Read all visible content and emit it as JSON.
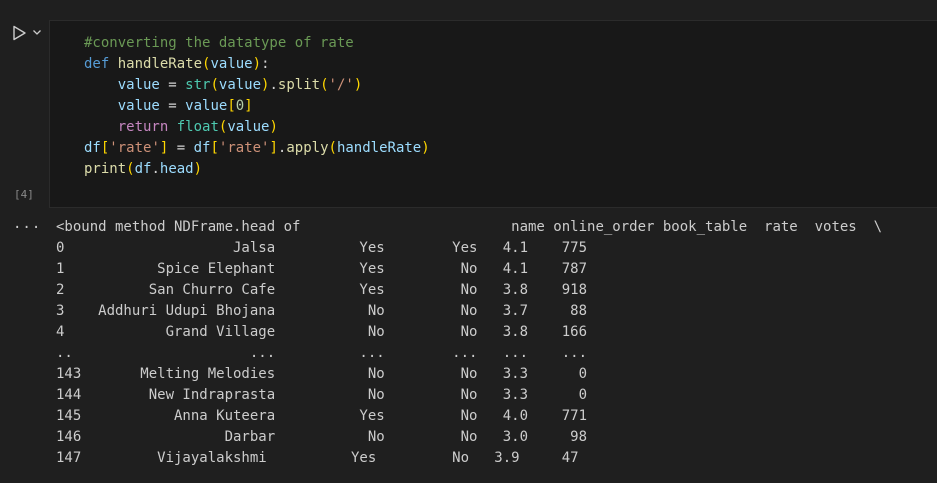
{
  "cell": {
    "execution_count": "[4]",
    "run_icon": "play-icon",
    "chevron_icon": "chevron-down-icon",
    "code_lines": [
      [
        {
          "t": "#converting the datatype of rate",
          "c": "comment"
        }
      ],
      [
        {
          "t": "def",
          "c": "kw"
        },
        {
          "t": " ",
          "c": "op"
        },
        {
          "t": "handleRate",
          "c": "fn"
        },
        {
          "t": "(",
          "c": "paren1"
        },
        {
          "t": "value",
          "c": "var"
        },
        {
          "t": ")",
          "c": "paren1"
        },
        {
          "t": ":",
          "c": "op"
        }
      ],
      [
        {
          "t": "    value",
          "c": "var"
        },
        {
          "t": " = ",
          "c": "op"
        },
        {
          "t": "str",
          "c": "builtin"
        },
        {
          "t": "(",
          "c": "paren1"
        },
        {
          "t": "value",
          "c": "var"
        },
        {
          "t": ")",
          "c": "paren1"
        },
        {
          "t": ".",
          "c": "op"
        },
        {
          "t": "split",
          "c": "fn"
        },
        {
          "t": "(",
          "c": "paren1"
        },
        {
          "t": "'/'",
          "c": "str"
        },
        {
          "t": ")",
          "c": "paren1"
        }
      ],
      [
        {
          "t": "    value",
          "c": "var"
        },
        {
          "t": " = ",
          "c": "op"
        },
        {
          "t": "value",
          "c": "var"
        },
        {
          "t": "[",
          "c": "paren1"
        },
        {
          "t": "0",
          "c": "num"
        },
        {
          "t": "]",
          "c": "paren1"
        }
      ],
      [
        {
          "t": "    return",
          "c": "ctrl"
        },
        {
          "t": " ",
          "c": "op"
        },
        {
          "t": "float",
          "c": "builtin"
        },
        {
          "t": "(",
          "c": "paren1"
        },
        {
          "t": "value",
          "c": "var"
        },
        {
          "t": ")",
          "c": "paren1"
        }
      ],
      [
        {
          "t": "df",
          "c": "var"
        },
        {
          "t": "[",
          "c": "paren1"
        },
        {
          "t": "'rate'",
          "c": "str"
        },
        {
          "t": "]",
          "c": "paren1"
        },
        {
          "t": " = ",
          "c": "op"
        },
        {
          "t": "df",
          "c": "var"
        },
        {
          "t": "[",
          "c": "paren1"
        },
        {
          "t": "'rate'",
          "c": "str"
        },
        {
          "t": "]",
          "c": "paren1"
        },
        {
          "t": ".",
          "c": "op"
        },
        {
          "t": "apply",
          "c": "fn"
        },
        {
          "t": "(",
          "c": "paren1"
        },
        {
          "t": "handleRate",
          "c": "var"
        },
        {
          "t": ")",
          "c": "paren1"
        }
      ],
      [
        {
          "t": "print",
          "c": "fn"
        },
        {
          "t": "(",
          "c": "paren1"
        },
        {
          "t": "df",
          "c": "var"
        },
        {
          "t": ".",
          "c": "op"
        },
        {
          "t": "head",
          "c": "var"
        },
        {
          "t": ")",
          "c": "paren1"
        }
      ]
    ]
  },
  "output": {
    "more_label": "...",
    "lines": [
      "<bound method NDFrame.head of                         name online_order book_table  rate  votes  \\",
      "0                    Jalsa          Yes        Yes   4.1    775",
      "1           Spice Elephant          Yes         No   4.1    787",
      "2          San Churro Cafe          Yes         No   3.8    918",
      "3    Addhuri Udupi Bhojana           No         No   3.7     88",
      "4            Grand Village           No         No   3.8    166",
      "..                     ...          ...        ...   ...    ...",
      "143       Melting Melodies           No         No   3.3      0",
      "144        New Indraprasta           No         No   3.3      0",
      "145           Anna Kuteera          Yes         No   4.0    771",
      "146                 Darbar           No         No   3.0     98",
      "147         Vijayalakshmi          Yes         No   3.9     47"
    ]
  }
}
